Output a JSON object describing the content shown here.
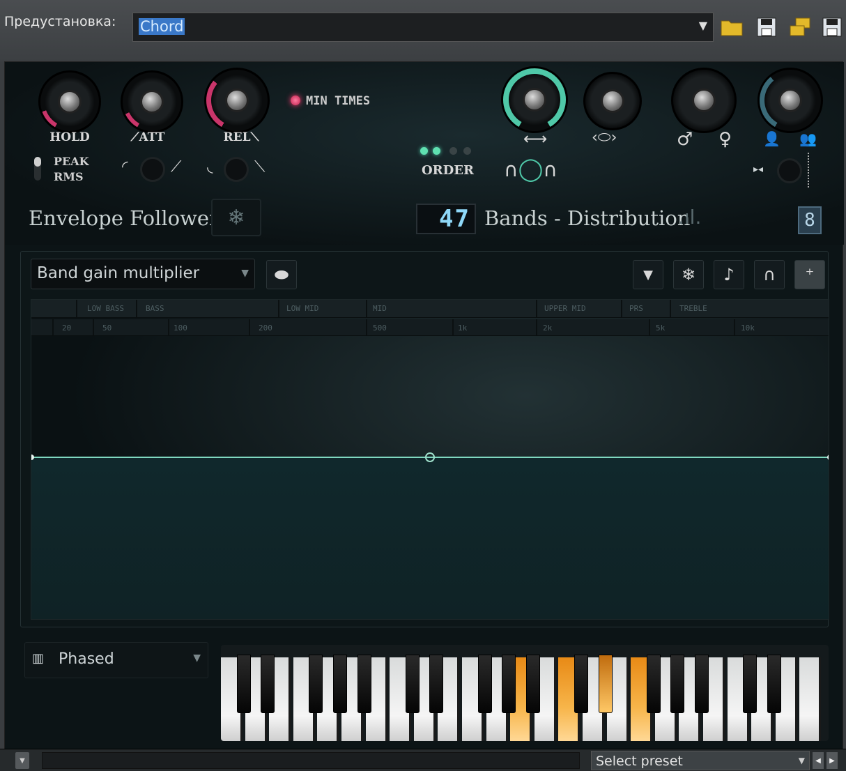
{
  "preset_bar": {
    "label": "Предустановка:",
    "value": "Chord",
    "icons": [
      "folder-icon",
      "save-icon",
      "copy-icon",
      "save-as-icon"
    ]
  },
  "envelope": {
    "hold_label": "HOLD",
    "att_label": "ATT",
    "rel_label": "REL",
    "peak_label": "PEAK",
    "rms_label": "RMS",
    "min_times_label": "MIN  TIMES",
    "order_label": "ORDER",
    "title": "Envelope Follower"
  },
  "bands": {
    "count_display": "47",
    "title": "Bands - Distribution",
    "small_display": "8"
  },
  "graph": {
    "mode_select": "Band gain multiplier",
    "ranges": [
      "LOW BASS",
      "BASS",
      "LOW MID",
      "MID",
      "UPPER MID",
      "PRS",
      "TREBLE"
    ],
    "freqs": [
      "20",
      "50",
      "100",
      "200",
      "500",
      "1k",
      "2k",
      "5k",
      "10k"
    ]
  },
  "bottom": {
    "keyboard_mode": "Phased",
    "status_preset": "Select preset"
  },
  "colors": {
    "accent_teal": "#4fc8a8",
    "accent_red": "#c9356a",
    "highlight_key": "#f4a640",
    "selection": "#3a78c8"
  }
}
